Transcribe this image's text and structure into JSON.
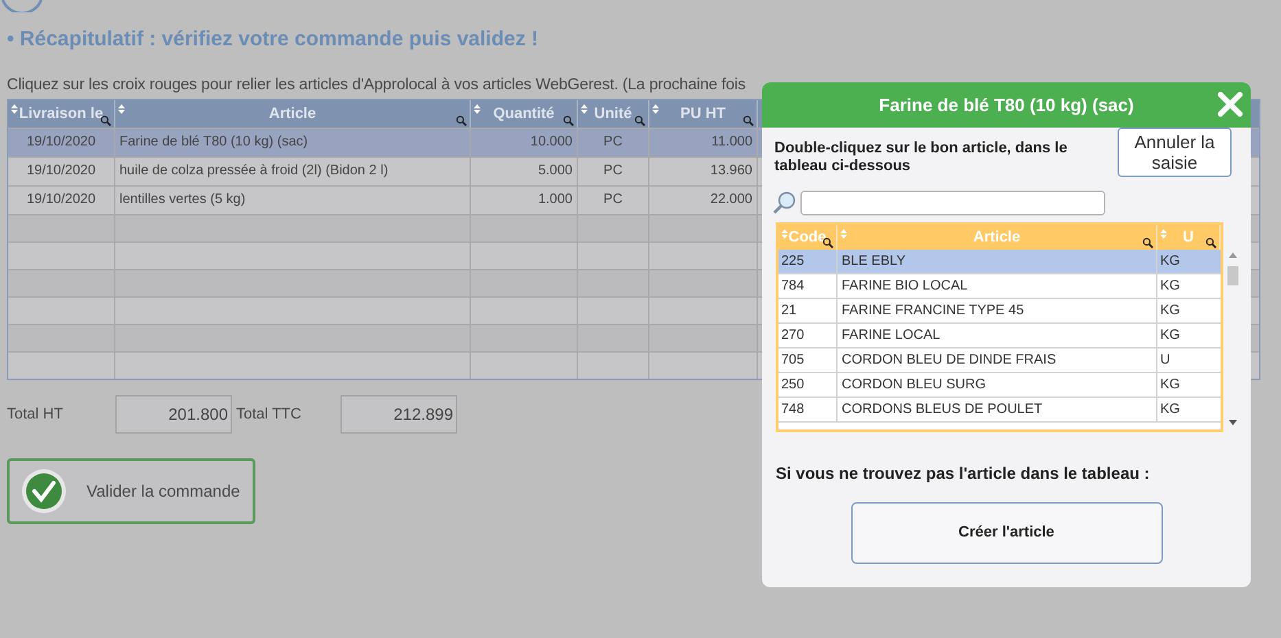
{
  "page": {
    "heading": "• Récapitulatif : vérifiez votre commande puis validez !",
    "intro": "Cliquez sur les croix rouges pour relier les articles d'Approlocal à vos articles WebGerest. (La prochaine fois"
  },
  "order_table": {
    "columns": [
      "Livraison le",
      "Article",
      "Quantité",
      "Unité",
      "PU HT"
    ],
    "rows": [
      {
        "cells": [
          "19/10/2020",
          "Farine de blé T80 (10 kg) (sac)",
          "10.000",
          "PC",
          "11.000"
        ],
        "selected": true
      },
      {
        "cells": [
          "19/10/2020",
          "huile de colza pressée à froid (2l) (Bidon 2 l)",
          "5.000",
          "PC",
          "13.960"
        ],
        "selected": false
      },
      {
        "cells": [
          "19/10/2020",
          "lentilles vertes (5 kg)",
          "1.000",
          "PC",
          "22.000"
        ],
        "selected": false
      }
    ]
  },
  "totals": [
    {
      "label": "Total HT",
      "value": "201.800"
    },
    {
      "label": "Total TTC",
      "value": "212.899"
    }
  ],
  "validate_button": {
    "label": "Valider la commande"
  },
  "dialog": {
    "title": "Farine de blé T80 (10 kg) (sac)",
    "instruction": "Double-cliquez sur le bon article, dans le tableau ci-dessous",
    "cancel_button": "Annuler la saisie",
    "columns": [
      "Code",
      "Article",
      "U"
    ],
    "rows": [
      {
        "code": "225",
        "article": "BLE EBLY",
        "unit": "KG",
        "selected": true
      },
      {
        "code": "784",
        "article": "FARINE BIO LOCAL",
        "unit": "KG",
        "selected": false
      },
      {
        "code": "21",
        "article": "FARINE FRANCINE TYPE 45",
        "unit": "KG",
        "selected": false
      },
      {
        "code": "270",
        "article": "FARINE LOCAL",
        "unit": "KG",
        "selected": false
      },
      {
        "code": "705",
        "article": "CORDON BLEU DE DINDE FRAIS",
        "unit": "U",
        "selected": false
      },
      {
        "code": "250",
        "article": "CORDON BLEU SURG",
        "unit": "KG",
        "selected": false
      },
      {
        "code": "748",
        "article": "CORDONS BLEUS DE POULET",
        "unit": "KG",
        "selected": false
      }
    ],
    "not_found_text": "Si vous ne trouvez pas l'article dans le tableau :",
    "create_button": "Créer l'article"
  }
}
